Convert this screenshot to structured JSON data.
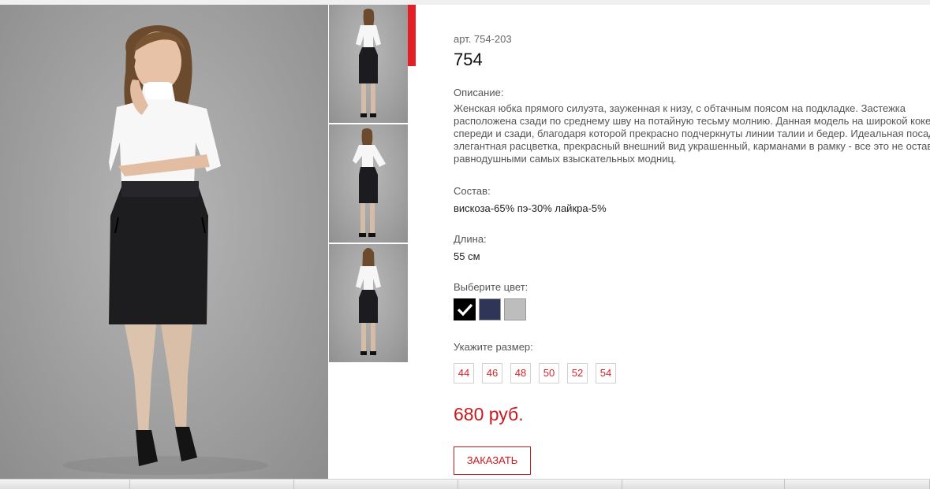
{
  "product": {
    "article": "арт. 754-203",
    "title": "754",
    "description_label": "Описание:",
    "description": "Женская юбка прямого силуэта, зауженная к низу, с обтачным поясом на подкладке. Застежка расположена сзади по среднему шву на потайную тесьму молнию. Данная модель на широкой кокетке спереди и сзади, благодаря которой прекрасно подчеркнуты линии талии и бедер. Идеальная посадка, элегантная расцветка, прекрасный внешний вид украшенный, карманами в рамку - все это не оставит равнодушными самых взыскательных модниц.",
    "composition_label": "Состав:",
    "composition": "вискоза-65% пэ-30% лайкра-5%",
    "length_label": "Длина:",
    "length": "55 см",
    "color_label": "Выберите цвет:",
    "colors": [
      {
        "hex": "#000000",
        "selected": true
      },
      {
        "hex": "#2e3556",
        "selected": false
      },
      {
        "hex": "#bdbdbd",
        "selected": false
      }
    ],
    "size_label": "Укажите размер:",
    "sizes": [
      "44",
      "46",
      "48",
      "50",
      "52",
      "54"
    ],
    "price": "680 руб.",
    "order_button": "ЗАКАЗАТЬ"
  },
  "gallery": {
    "thumbnails": [
      "front-view",
      "side-view",
      "back-view"
    ]
  },
  "colors": {
    "accent": "#e31e24",
    "price": "#c8191f",
    "size_text": "#d2262b"
  }
}
